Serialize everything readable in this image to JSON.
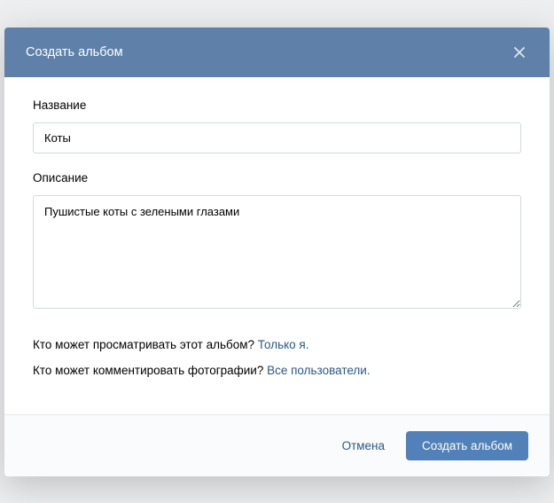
{
  "modal": {
    "title": "Создать альбом"
  },
  "form": {
    "name_label": "Название",
    "name_value": "Коты",
    "description_label": "Описание",
    "description_value": "Пушистые коты с зелеными глазами"
  },
  "privacy": {
    "view_question": "Кто может просматривать этот альбом? ",
    "view_value": "Только я.",
    "comment_question": "Кто может комментировать фотографии? ",
    "comment_value": "Все пользователи."
  },
  "footer": {
    "cancel": "Отмена",
    "submit": "Создать альбом"
  }
}
